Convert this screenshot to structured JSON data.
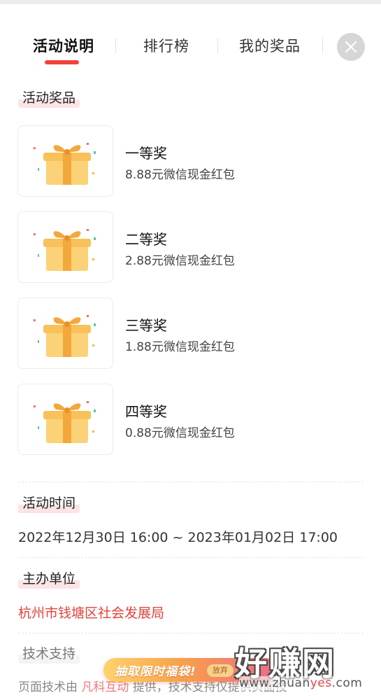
{
  "tabs": [
    {
      "label": "活动说明",
      "active": true
    },
    {
      "label": "排行榜",
      "active": false
    },
    {
      "label": "我的奖品",
      "active": false
    }
  ],
  "close_icon": "close-icon",
  "prizes_section": {
    "title": "活动奖品",
    "items": [
      {
        "name": "一等奖",
        "desc": "8.88元微信现金红包",
        "icon": "gift-box-icon"
      },
      {
        "name": "二等奖",
        "desc": "2.88元微信现金红包",
        "icon": "gift-box-icon"
      },
      {
        "name": "三等奖",
        "desc": "1.88元微信现金红包",
        "icon": "gift-box-icon"
      },
      {
        "name": "四等奖",
        "desc": "0.88元微信现金红包",
        "icon": "gift-box-icon"
      }
    ]
  },
  "time_section": {
    "title": "活动时间",
    "value": "2022年12月30日 16:00 ~ 2023年01月02日 17:00"
  },
  "organizer_section": {
    "title": "主办单位",
    "value": "杭州市钱塘区社会发展局"
  },
  "tech_section": {
    "title": "技术支持",
    "prefix": "页面技术由",
    "highlight": "凡科互动",
    "suffix": "提供，技术支持仅提供页面技"
  },
  "promo": {
    "label": "抽取限时福袋!",
    "tag": "放弃"
  },
  "watermark": {
    "big": "好赚网",
    "small_prefix": "www.zhuan",
    "small_highlight": "yes",
    "small_suffix": ".com"
  },
  "colors": {
    "accent": "#f0433c",
    "organizer": "#e1423a",
    "highlight_bg": "#fde4e4"
  }
}
